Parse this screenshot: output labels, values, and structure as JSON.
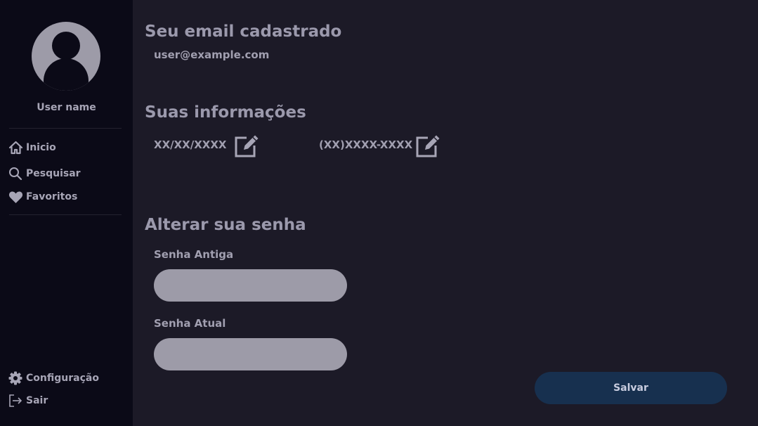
{
  "sidebar": {
    "username": "User name",
    "nav": [
      {
        "label": "Inicio",
        "icon": "home-icon"
      },
      {
        "label": "Pesquisar",
        "icon": "search-icon"
      },
      {
        "label": "Favoritos",
        "icon": "heart-icon"
      }
    ],
    "bottom": [
      {
        "label": "Configuração",
        "icon": "gear-icon"
      },
      {
        "label": "Sair",
        "icon": "logout-icon"
      }
    ]
  },
  "main": {
    "email_title": "Seu email cadastrado",
    "email_value": "user@example.com",
    "info_title": "Suas informações",
    "birthdate": "XX/XX/XXXX",
    "phone": "(XX)XXXX-XXXX",
    "password_title": "Alterar sua senha",
    "old_password_label": "Senha Antiga",
    "old_password_value": "",
    "current_password_label": "Senha Atual",
    "current_password_value": "",
    "save_label": "Salvar"
  },
  "colors": {
    "background": "#1c1a27",
    "sidebar": "#0b0a17",
    "text": "#9b99ac",
    "input": "#9d9ba8",
    "button": "#17304f"
  }
}
